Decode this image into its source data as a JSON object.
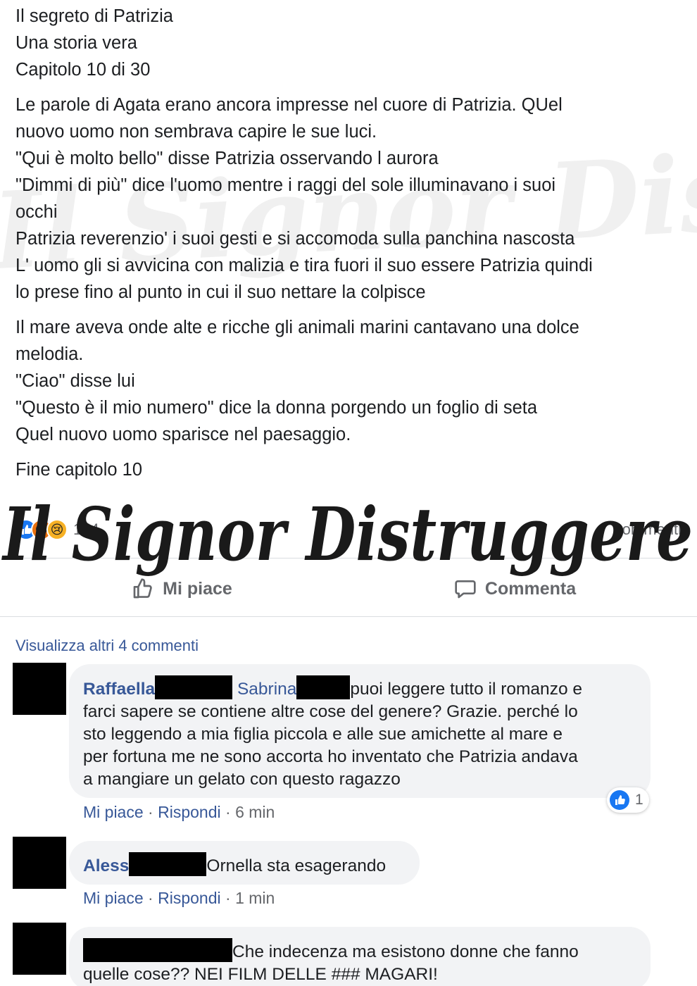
{
  "post": {
    "paragraphs": [
      [
        "Il segreto di Patrizia",
        "Una storia vera",
        "Capitolo 10 di 30"
      ],
      [
        "Le parole di Agata erano ancora impresse nel cuore di Patrizia. QUel",
        "nuovo uomo non sembrava capire le sue luci.",
        "\"Qui è molto bello\" disse Patrizia osservando l aurora",
        "\"Dimmi di più\" dice l'uomo mentre i raggi del sole illuminavano i suoi",
        "occhi",
        "Patrizia reverenzio' i suoi gesti e si accomoda sulla panchina nascosta",
        "L' uomo gli si avvicina con malizia e tira fuori il suo essere Patrizia quindi",
        "lo prese fino al punto in cui il suo nettare la colpisce"
      ],
      [
        "Il mare aveva onde alte e ricche gli animali marini cantavano una dolce",
        "melodia.",
        "\"Ciao\" disse lui",
        "\"Questo è il mio numero\" dice la donna porgendo un foglio di seta",
        "Quel nuovo uomo sparisce nel paesaggio."
      ],
      [
        "Fine capitolo 10"
      ]
    ]
  },
  "reactions": {
    "icons": [
      "like-icon",
      "angry-icon",
      "sad-icon"
    ],
    "count": "154",
    "comments_label": "commenti"
  },
  "actions": {
    "like_label": "Mi piace",
    "comment_label": "Commenta"
  },
  "comments": {
    "view_more": "Visualizza altri 4 commenti",
    "items": [
      {
        "author": "Raffaella",
        "tag": "Sabrina",
        "text_first": "puoi leggere tutto il romanzo e",
        "text_rest": [
          "farci sapere se contiene altre cose del genere? Grazie. perché lo",
          "sto leggendo a mia figlia piccola e alle sue amichette al mare e",
          "per fortuna me ne sono accorta ho inventato che Patrizia andava",
          "a mangiare un gelato con questo ragazzo"
        ],
        "like_label": "Mi piace",
        "reply_label": "Rispondi",
        "time": "6 min",
        "likes": "1"
      },
      {
        "author": "Aless",
        "text": "Ornella sta esagerando",
        "like_label": "Mi piace",
        "reply_label": "Rispondi",
        "time": "1 min"
      },
      {
        "text_first": "Che indecenza ma esistono donne che fanno",
        "text_second": "quelle cose?? NEI FILM DELLE ### MAGARI!"
      }
    ]
  },
  "watermark": {
    "text": "Il Signor Distruggere"
  }
}
